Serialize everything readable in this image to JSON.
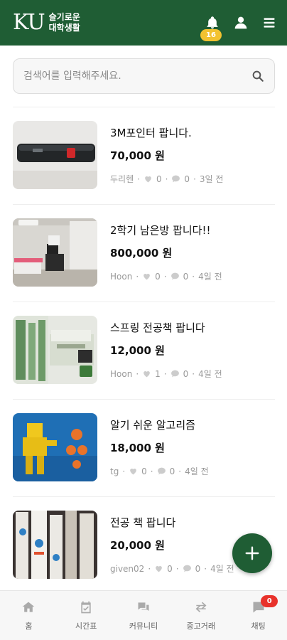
{
  "header": {
    "logo_text": "KU",
    "logo_sub_line1": "슬기로운",
    "logo_sub_line2": "대학생활",
    "notification_count": "16",
    "colors": {
      "brand": "#1f5d34",
      "badge": "#f2c230"
    }
  },
  "search": {
    "placeholder": "검색어를 입력해주세요."
  },
  "listings": [
    {
      "title": "3M포인터 팝니다.",
      "price": "70,000 원",
      "seller": "두리헨",
      "likes": "0",
      "comments": "0",
      "time": "3일 전",
      "thumbnail": "laser-pointer-photo"
    },
    {
      "title": "2학기 남은방 팝니다!!",
      "price": "800,000 원",
      "seller": "Hoon",
      "likes": "0",
      "comments": "0",
      "time": "4일 전",
      "thumbnail": "room-photo"
    },
    {
      "title": "스프링 전공책 팝니다",
      "price": "12,000 원",
      "seller": "Hoon",
      "likes": "1",
      "comments": "0",
      "time": "4일 전",
      "thumbnail": "spring-book-cover"
    },
    {
      "title": "알기 쉬운 알고리즘",
      "price": "18,000 원",
      "seller": "tg",
      "likes": "0",
      "comments": "0",
      "time": "4일 전",
      "thumbnail": "algorithm-book-cover"
    },
    {
      "title": "전공 책 팝니다",
      "price": "20,000 원",
      "seller": "given02",
      "likes": "0",
      "comments": "0",
      "time": "4일 전",
      "thumbnail": "centos-books-photo"
    }
  ],
  "fab": {
    "icon": "plus-icon"
  },
  "bottom_nav": [
    {
      "label": "홈",
      "icon": "home-icon"
    },
    {
      "label": "시간표",
      "icon": "calendar-icon"
    },
    {
      "label": "커뮤니티",
      "icon": "chat-bubbles-icon"
    },
    {
      "label": "중고거래",
      "icon": "exchange-icon"
    },
    {
      "label": "채팅",
      "icon": "chat-icon",
      "badge": "0"
    }
  ]
}
